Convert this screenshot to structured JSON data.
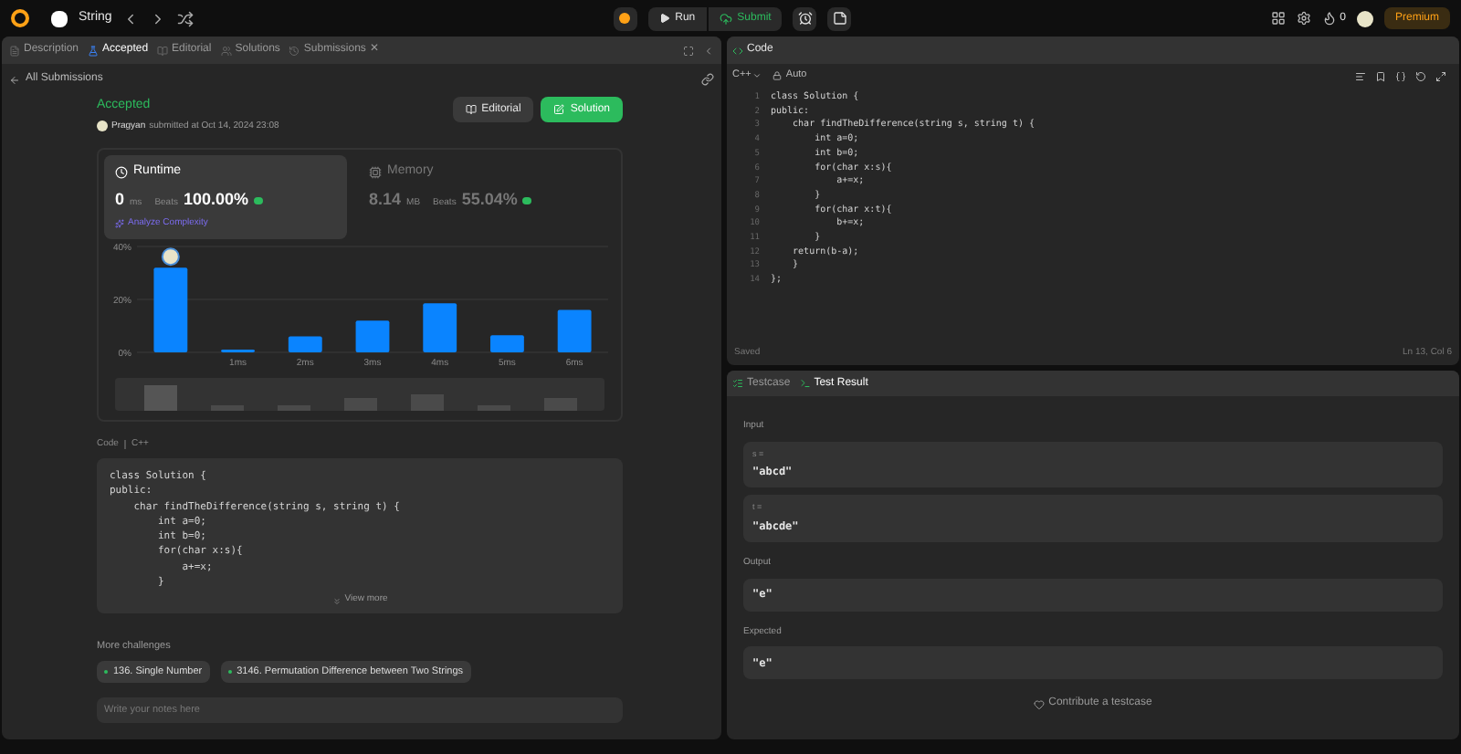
{
  "topbar": {
    "problem": "String",
    "run": "Run",
    "submit": "Submit",
    "streak": "0",
    "premium": "Premium"
  },
  "left_tabs": [
    {
      "label": "Description",
      "selected": false
    },
    {
      "label": "Accepted",
      "selected": true
    },
    {
      "label": "Editorial",
      "selected": false
    },
    {
      "label": "Solutions",
      "selected": false
    },
    {
      "label": "Submissions",
      "selected": false
    }
  ],
  "close_tab": "✕",
  "back_link": "All Submissions",
  "submission": {
    "status": "Accepted",
    "user": "Pragyan",
    "submitted": "submitted at Oct 14, 2024 23:08",
    "editorial": "Editorial",
    "solution": "Solution"
  },
  "runtime": {
    "title": "Runtime",
    "value": "0",
    "unit": "ms",
    "beats_label": "Beats",
    "beats": "100.00%",
    "analyze": "Analyze Complexity",
    "selected": true
  },
  "memory": {
    "title": "Memory",
    "value": "8.14",
    "unit": "MB",
    "beats_label": "Beats",
    "beats": "55.04%",
    "selected": false
  },
  "chart_data": {
    "type": "bar",
    "x": [
      0,
      1,
      2,
      3,
      4,
      5,
      6
    ],
    "values": [
      32,
      1,
      6,
      12,
      18.5,
      6.5,
      16
    ],
    "xlim": [
      -0.5,
      6.5
    ],
    "ylim": [
      0,
      40
    ],
    "yticks": [
      {
        "value": 0,
        "label": "0%"
      },
      {
        "value": 20,
        "label": "20%"
      },
      {
        "value": 40,
        "label": "40%"
      }
    ],
    "xticks": [
      {
        "value": 1,
        "label": "1ms"
      },
      {
        "value": 2,
        "label": "2ms"
      },
      {
        "value": 3,
        "label": "3ms"
      },
      {
        "value": 4,
        "label": "4ms"
      },
      {
        "value": 5,
        "label": "5ms"
      },
      {
        "value": 6,
        "label": "6ms"
      }
    ]
  },
  "code_label": "Code",
  "code_lang": "C++",
  "submitted_code": [
    "class Solution {",
    "public:",
    "    char findTheDifference(string s, string t) {",
    "        int a=0;",
    "        int b=0;",
    "        for(char x:s){",
    "            a+=x;",
    "        }"
  ],
  "view_more": "View more",
  "more_challenges": {
    "title": "More challenges",
    "items": [
      "136. Single Number",
      "3146. Permutation Difference between Two Strings"
    ]
  },
  "notes": {
    "placeholder": "Write your notes here"
  },
  "editor": {
    "tab": "Code",
    "language": "C++",
    "mode": "Auto",
    "lines": [
      {
        "num": "1",
        "text": "class Solution {"
      },
      {
        "num": "2",
        "text": "public:"
      },
      {
        "num": "3",
        "text": "    char findTheDifference(string s, string t) {"
      },
      {
        "num": "4",
        "text": "        int a=0;"
      },
      {
        "num": "5",
        "text": "        int b=0;"
      },
      {
        "num": "6",
        "text": "        for(char x:s){"
      },
      {
        "num": "7",
        "text": "            a+=x;"
      },
      {
        "num": "8",
        "text": "        }"
      },
      {
        "num": "9",
        "text": "        for(char x:t){"
      },
      {
        "num": "10",
        "text": "            b+=x;"
      },
      {
        "num": "11",
        "text": "        }"
      },
      {
        "num": "12",
        "text": "    return(b-a);"
      },
      {
        "num": "13",
        "text": "    }"
      },
      {
        "num": "14",
        "text": "};"
      }
    ],
    "status": "Saved",
    "position": "Ln 13, Col 6"
  },
  "test_tabs": [
    {
      "label": "Testcase",
      "selected": false
    },
    {
      "label": "Test Result",
      "selected": true
    }
  ],
  "result": {
    "input_label": "Input",
    "inputs": [
      {
        "name": "s =",
        "value": "\"abcd\""
      },
      {
        "name": "t =",
        "value": "\"abcde\""
      }
    ],
    "output_label": "Output",
    "output": "\"e\"",
    "expected_label": "Expected",
    "expected": "\"e\"",
    "contribute": "Contribute a testcase"
  }
}
